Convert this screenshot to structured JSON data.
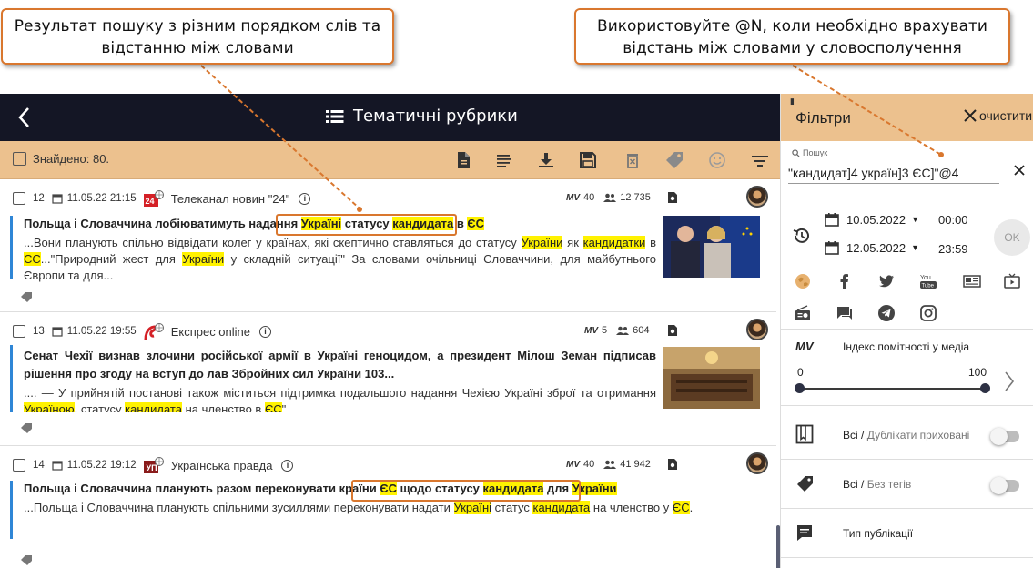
{
  "callouts": {
    "left_line1": "Результат пошуку з різним порядком слів та",
    "left_line2": "відстанню між словами",
    "right_line1": "Використовуйте  @N, коли необхідно врахувати",
    "right_line2": "відстань між словами у словосполучення"
  },
  "header": {
    "title": "Тематичні рубрики",
    "found_label": "Знайдено: 80."
  },
  "articles": [
    {
      "number": "12",
      "datetime": "11.05.22 21:15",
      "source": "Телеканал новин \"24\"",
      "mv": "40",
      "audience": "12 735",
      "headline": {
        "pre": "Польща і Словаччина лобіюватимуть надання ",
        "h1": "Україні",
        "mid1": " статусу ",
        "h2": "кандидата",
        "mid2": " в ",
        "h3": "ЄС",
        "post": ""
      },
      "snippet": {
        "p1": "...Вони планують спільно відвідати колег у країнах, які скептично ставляться до статусу ",
        "h1": "України",
        "p2": " як ",
        "h2": "кандидатки",
        "p3": " в ",
        "h3": "ЄС",
        "p4": "...\"Природний жест для ",
        "h4": "України",
        "p5": " у складній ситуації\" За словами очільниці Словаччини, для майбутнього Європи та для..."
      }
    },
    {
      "number": "13",
      "datetime": "11.05.22 19:55",
      "source": "Експрес online",
      "mv": "5",
      "audience": "604",
      "headline": {
        "pre": "Сенат Чехії визнав злочини російської армії в Україні геноцидом, а президент Мілош Земан підписав рішення про згоду на вступ до лав Збройних сил України 103..."
      },
      "snippet": {
        "p1": ".... — У прийнятій постанові також міститься підтримка подальшого надання Чехією Україні зброї та отримання ",
        "h1": "Україною",
        "p2": ", статусу ",
        "h2": "кандидата",
        "p3": " на членство в ",
        "h3": "ЄС",
        "p4": "\""
      }
    },
    {
      "number": "14",
      "datetime": "11.05.22 19:12",
      "source": "Українська правда",
      "mv": "40",
      "audience": "41 942",
      "headline": {
        "pre": "Польща і Словаччина планують разом переконувати країни ",
        "h1": "ЄС",
        "mid1": " щодо статусу ",
        "h2": "кандидата",
        "mid2": " для ",
        "h3": "України",
        "post": ""
      },
      "snippet": {
        "p1": "...Польща і Словаччина планують спільними зусиллями переконувати надати ",
        "h1": "Україні",
        "p2": " статус ",
        "h2": "кандидата",
        "p3": " на членство у ",
        "h3": "ЄС",
        "p4": "."
      }
    }
  ],
  "filters": {
    "title": "Фільтри",
    "clear_label": "очистити",
    "search_label": "Пошук",
    "search_value": "\"кандидат]4 україн]3 ЄС]\"@4",
    "date_from": "10.05.2022",
    "time_from": "00:00",
    "date_to": "12.05.2022",
    "time_to": "23:59",
    "ok_label": "OK",
    "mv_label": "MV",
    "mv_title": "Індекс помітності у медіа",
    "range_min": "0",
    "range_max": "100",
    "range_low": 0,
    "range_high": 100,
    "duplicates_main": "Всі",
    "duplicates_sub": "Дублікати приховані",
    "tags_main": "Всі",
    "tags_sub": "Без тегів",
    "pub_type": "Тип публікації"
  },
  "colors": {
    "accent": "#ecc18e",
    "topbar": "#141625",
    "highlight": "#fff200",
    "callout_border": "#d9772e",
    "article_bar": "#2f86d6"
  }
}
